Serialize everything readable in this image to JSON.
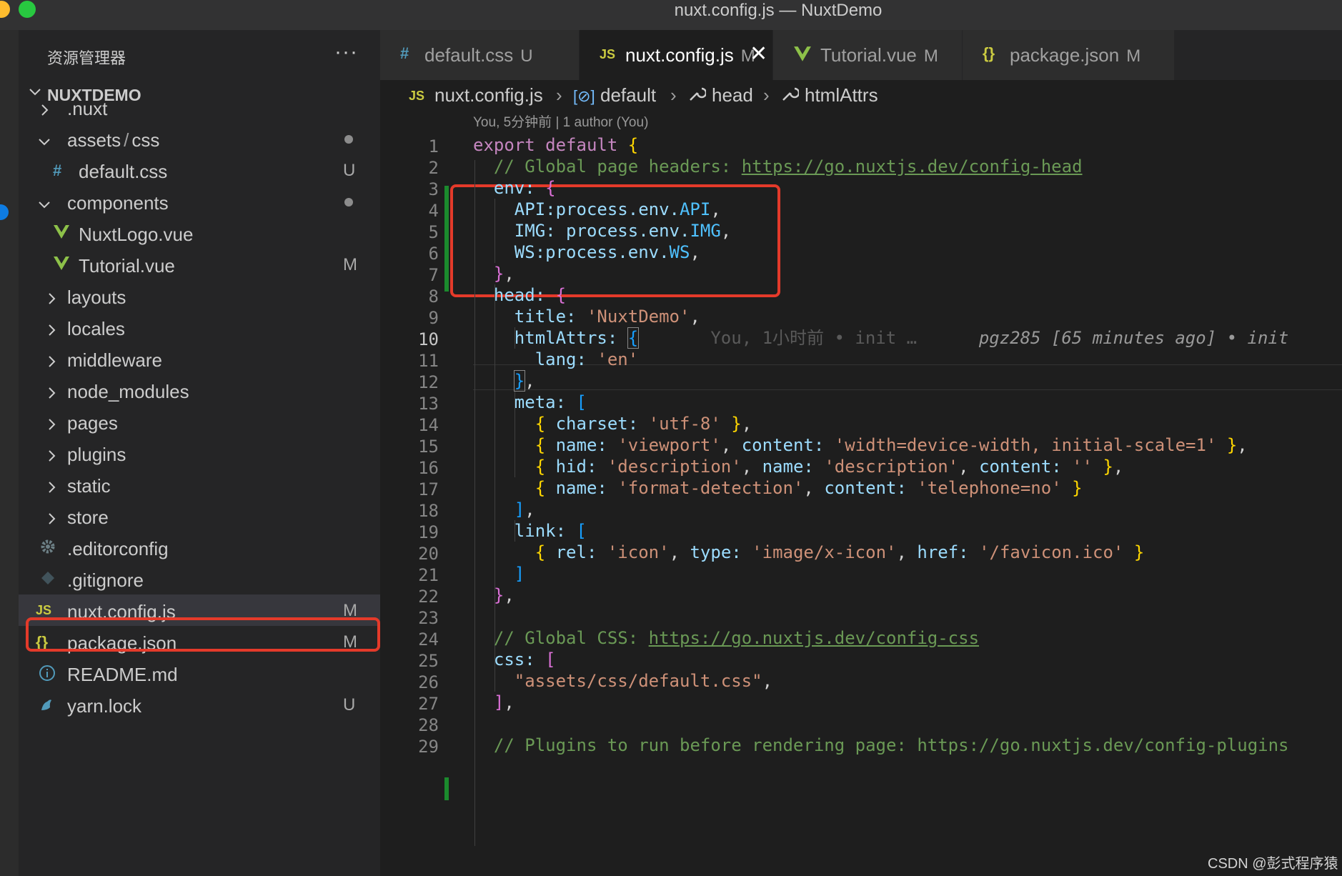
{
  "window": {
    "title": "nuxt.config.js — NuxtDemo"
  },
  "sidebar": {
    "title": "资源管理器",
    "more": "···",
    "root": "NUXTDEMO",
    "items": [
      {
        "label": ".nuxt",
        "type": "folder",
        "expanded": false
      },
      {
        "label_a": "assets",
        "sep": "/",
        "label_b": "css",
        "type": "folder",
        "expanded": true,
        "dot": true
      },
      {
        "label": "default.css",
        "type": "css",
        "badge": "U"
      },
      {
        "label": "components",
        "type": "folder",
        "expanded": true,
        "dot": true
      },
      {
        "label": "NuxtLogo.vue",
        "type": "vue"
      },
      {
        "label": "Tutorial.vue",
        "type": "vue",
        "badge": "M"
      },
      {
        "label": "layouts",
        "type": "folder",
        "expanded": false
      },
      {
        "label": "locales",
        "type": "folder",
        "expanded": false
      },
      {
        "label": "middleware",
        "type": "folder",
        "expanded": false
      },
      {
        "label": "node_modules",
        "type": "folder",
        "expanded": false
      },
      {
        "label": "pages",
        "type": "folder",
        "expanded": false
      },
      {
        "label": "plugins",
        "type": "folder",
        "expanded": false
      },
      {
        "label": "static",
        "type": "folder",
        "expanded": false
      },
      {
        "label": "store",
        "type": "folder",
        "expanded": false
      },
      {
        "label": ".editorconfig",
        "type": "config"
      },
      {
        "label": ".gitignore",
        "type": "git"
      },
      {
        "label": "nuxt.config.js",
        "type": "js",
        "badge": "M",
        "selected": true
      },
      {
        "label": "package.json",
        "type": "json",
        "badge": "M"
      },
      {
        "label": "README.md",
        "type": "info"
      },
      {
        "label": "yarn.lock",
        "type": "yarn",
        "badge": "U"
      }
    ]
  },
  "tabs": [
    {
      "icon": "#",
      "label": "default.css",
      "state": "U"
    },
    {
      "icon": "JS",
      "label": "nuxt.config.js",
      "state": "M",
      "active": true,
      "close": "✕"
    },
    {
      "icon": "V",
      "label": "Tutorial.vue",
      "state": "M"
    },
    {
      "icon": "{}",
      "label": "package.json",
      "state": "M"
    }
  ],
  "breadcrumb": {
    "file_icon": "JS",
    "file": "nuxt.config.js",
    "sep": "›",
    "sym_icon": "[⊘]",
    "symbol1": "default",
    "symbol2": "head",
    "symbol3": "htmlAttrs",
    "tool_icon": "🔧"
  },
  "codelens": "You, 5分钟前 | 1 author (You)",
  "editor": {
    "line_numbers": [
      "1",
      "2",
      "3",
      "4",
      "5",
      "6",
      "7",
      "8",
      "9",
      "10",
      "11",
      "12",
      "13",
      "14",
      "15",
      "16",
      "17",
      "18",
      "19",
      "20",
      "21",
      "22",
      "23",
      "24",
      "25",
      "26",
      "27",
      "28",
      "29"
    ],
    "current_line": "10",
    "blame_inline_a": "You, 1小时前 • init …",
    "blame_inline_b": "pgz285 [65 minutes ago] • init",
    "code": {
      "l1a": "export default",
      "l1b": "{",
      "l2a": "// Global page headers: ",
      "l2b": "https://go.nuxtjs.dev/config-head",
      "l3a": "env:",
      "l3b": "{",
      "l4a": "API:",
      "l4b": "process.env.",
      "l4c": "API",
      "l4d": ",",
      "l5a": "IMG:",
      "l5b": " process.env.",
      "l5c": "IMG",
      "l5d": ",",
      "l6a": "WS:",
      "l6b": "process.env.",
      "l6c": "WS",
      "l6d": ",",
      "l7a": "}",
      "l7b": ",",
      "l8a": "head:",
      "l8b": "{",
      "l9a": "title:",
      "l9b": "'NuxtDemo'",
      "l9c": ",",
      "l10a": "htmlAttrs:",
      "l10b": "{",
      "l11a": "lang:",
      "l11b": "'en'",
      "l12a": "}",
      "l12b": ",",
      "l13a": "meta:",
      "l13b": "[",
      "l14a": "{",
      "l14b": "charset:",
      "l14c": "'utf-8'",
      "l14d": "}",
      "l14e": ",",
      "l15a": "{",
      "l15b": "name:",
      "l15c": "'viewport'",
      "l15d": ", ",
      "l15e": "content:",
      "l15f": "'width=device-width, initial-scale=1'",
      "l15g": "}",
      "l15h": ",",
      "l16a": "{",
      "l16b": "hid:",
      "l16c": "'description'",
      "l16d": ", ",
      "l16e": "name:",
      "l16f": "'description'",
      "l16g": ", ",
      "l16h": "content:",
      "l16i": "''",
      "l16j": "}",
      "l16k": ",",
      "l17a": "{",
      "l17b": "name:",
      "l17c": "'format-detection'",
      "l17d": ", ",
      "l17e": "content:",
      "l17f": "'telephone=no'",
      "l17g": "}",
      "l18a": "]",
      "l18b": ",",
      "l19a": "link:",
      "l19b": "[",
      "l20a": "{",
      "l20b": "rel:",
      "l20c": "'icon'",
      "l20d": ", ",
      "l20e": "type:",
      "l20f": "'image/x-icon'",
      "l20g": ", ",
      "l20h": "href:",
      "l20i": "'/favicon.ico'",
      "l20j": "}",
      "l21a": "]",
      "l22a": "}",
      "l22b": ",",
      "l24a": "// Global CSS: ",
      "l24b": "https://go.nuxtjs.dev/config-css",
      "l25a": "css:",
      "l25b": "[",
      "l26a": "\"assets/css/default.css\"",
      "l26b": ",",
      "l27a": "]",
      "l27b": ",",
      "l29a": "// Plugins to run before rendering page: https://go.nuxtjs.dev/config-plugins"
    }
  },
  "watermark": "CSDN @彭式程序猿",
  "colors": {
    "accent_red": "#e43a2a",
    "git_added": "#1b8a2d",
    "js_icon": "#cbcb41",
    "vue_icon": "#8dc149",
    "css_icon": "#519aba"
  }
}
